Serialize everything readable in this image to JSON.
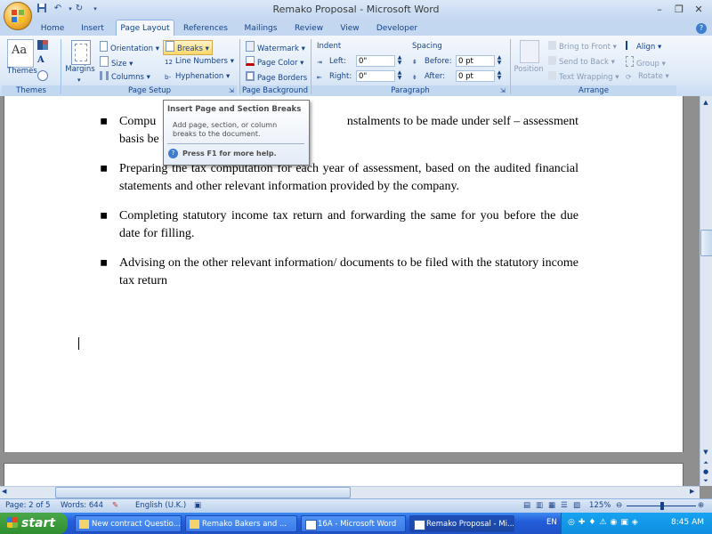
{
  "window": {
    "title": "Remako Proposal - Microsoft Word"
  },
  "tabs": [
    "Home",
    "Insert",
    "Page Layout",
    "References",
    "Mailings",
    "Review",
    "View",
    "Developer"
  ],
  "active_tab": "Page Layout",
  "ribbon": {
    "themes": {
      "label": "Themes",
      "group": "Themes"
    },
    "page_setup": {
      "margins": "Margins",
      "orientation": "Orientation",
      "size": "Size",
      "columns": "Columns",
      "breaks": "Breaks",
      "line_numbers": "Line Numbers",
      "hyphenation": "Hyphenation",
      "group": "Page Setup"
    },
    "page_background": {
      "watermark": "Watermark",
      "page_color": "Page Color",
      "page_borders": "Page Borders",
      "group": "Page Background"
    },
    "paragraph": {
      "indent_label": "Indent",
      "left_label": "Left:",
      "left_value": "0\"",
      "right_label": "Right:",
      "right_value": "0\"",
      "spacing_label": "Spacing",
      "before_label": "Before:",
      "before_value": "0 pt",
      "after_label": "After:",
      "after_value": "0 pt",
      "group": "Paragraph"
    },
    "arrange": {
      "position": "Position",
      "bring_to_front": "Bring to Front",
      "send_to_back": "Send to Back",
      "text_wrapping": "Text Wrapping",
      "align": "Align",
      "group_btn": "Group",
      "rotate": "Rotate",
      "group": "Arrange"
    }
  },
  "tooltip": {
    "title": "Insert Page and Section Breaks",
    "body": "Add page, section, or column breaks to the document.",
    "help": "Press F1 for more help."
  },
  "document": {
    "bullets": [
      "Computing the tax instalments to be made under self – assessment basis before",
      "Preparing the tax computation for each year of assessment, based on the audited financial statements and other relevant information provided by the company.",
      "Completing statutory income tax return and forwarding the same for you before the due date for filling.",
      "Advising on the other relevant information/ documents to be filed with the statutory income tax return"
    ],
    "bullet_visible_first_line_left": "Compu",
    "bullet_visible_first_line_right": "nstalments to be made under self – assessment",
    "bullet_visible_second_line": "basis be"
  },
  "statusbar": {
    "page": "Page: 2 of 5",
    "words": "Words: 644",
    "language": "English (U.K.)",
    "zoom": "125%"
  },
  "taskbar": {
    "start": "start",
    "tasks": [
      "New contract Questio...",
      "Remako Bakers and ...",
      "16A - Microsoft Word",
      "Remako Proposal - Mi..."
    ],
    "active_task": "Remako Proposal - Mi...",
    "lang": "EN",
    "clock": "8:45 AM"
  }
}
